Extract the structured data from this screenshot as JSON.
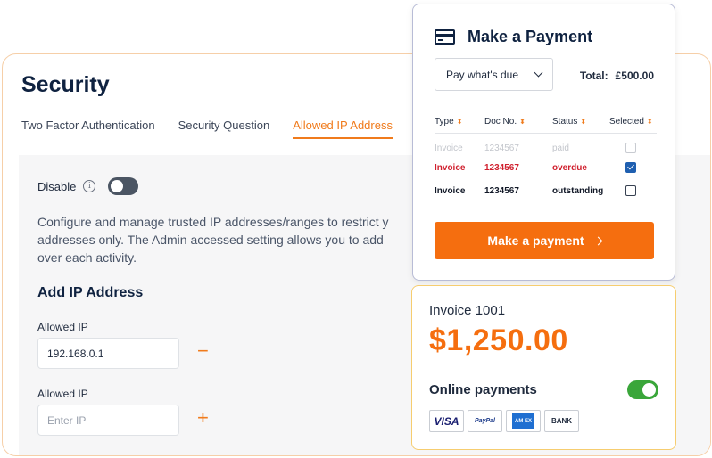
{
  "security": {
    "title": "Security",
    "tabs": [
      {
        "label": "Two Factor Authentication"
      },
      {
        "label": "Security Question"
      },
      {
        "label": "Allowed IP Address"
      }
    ],
    "disable_label": "Disable",
    "disable_toggle_on": false,
    "description": "Configure and manage trusted IP addresses/ranges to restrict y\naddresses only. The Admin accessed setting allows you to add\nover each activity.",
    "add_heading": "Add IP Address",
    "ip_fields": [
      {
        "label": "Allowed IP",
        "value": "192.168.0.1",
        "placeholder": "",
        "action": "−"
      },
      {
        "label": "Allowed IP",
        "value": "",
        "placeholder": "Enter IP",
        "action": "+"
      }
    ]
  },
  "payment": {
    "title": "Make a Payment",
    "select_value": "Pay what's due",
    "total_label": "Total:",
    "total_value": "£500.00",
    "columns": [
      "Type",
      "Doc No.",
      "Status",
      "Selected"
    ],
    "sort_icon": "⬍",
    "rows": [
      {
        "type": "Invoice",
        "doc": "1234567",
        "status": "paid",
        "selected": false
      },
      {
        "type": "Invoice",
        "doc": "1234567",
        "status": "overdue",
        "selected": true
      },
      {
        "type": "Invoice",
        "doc": "1234567",
        "status": "outstanding",
        "selected": false
      }
    ],
    "button_label": "Make a payment"
  },
  "invoice": {
    "number": "Invoice 1001",
    "amount": "$1,250.00",
    "online_label": "Online payments",
    "online_toggle_on": true,
    "methods": [
      {
        "name": "visa",
        "label": "VISA"
      },
      {
        "name": "paypal",
        "label": "PayPal"
      },
      {
        "name": "amex",
        "label": "AM EX"
      },
      {
        "name": "bank",
        "label": "BANK"
      }
    ]
  },
  "colors": {
    "accent": "#f56e0f",
    "navy": "#0f2240",
    "overdue": "#d0202e",
    "toggle_on": "#3aa63a"
  }
}
